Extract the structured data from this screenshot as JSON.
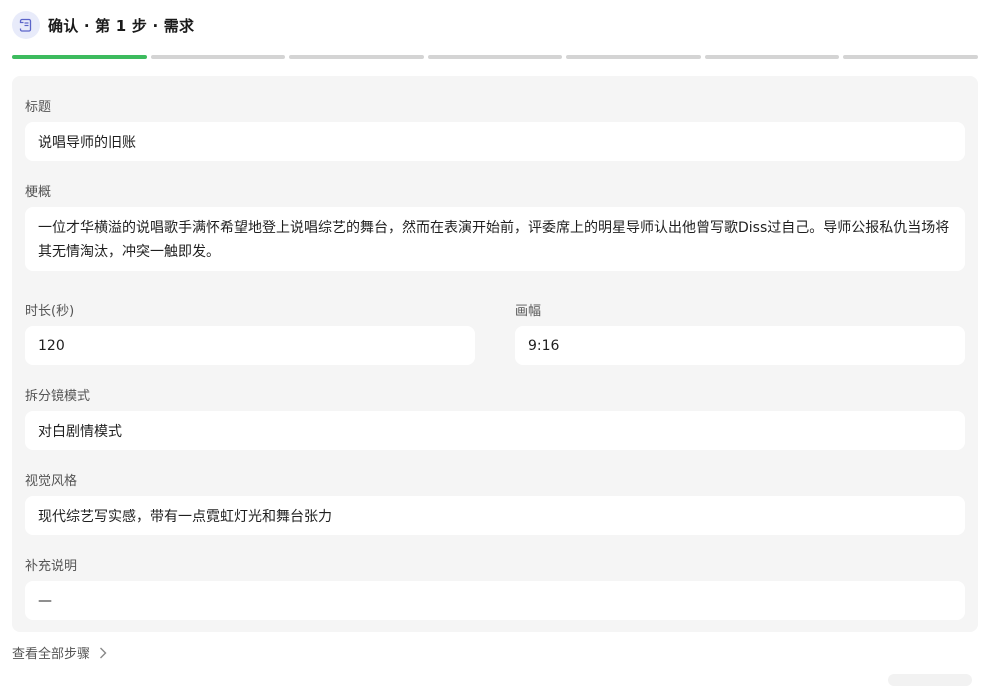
{
  "header": {
    "title": "确认 · 第 1 步 · 需求",
    "icon": "scroll-icon"
  },
  "progress": {
    "total_steps": 7,
    "current_step": 1,
    "done_color": "#3dbb5e",
    "todo_color": "#d4d4d4"
  },
  "form": {
    "title_label": "标题",
    "title_value": "说唱导师的旧账",
    "synopsis_label": "梗概",
    "synopsis_value": "一位才华横溢的说唱歌手满怀希望地登上说唱综艺的舞台，然而在表演开始前，评委席上的明星导师认出他曾写歌Diss过自己。导师公报私仇当场将其无情淘汰，冲突一触即发。",
    "duration_label": "时长(秒)",
    "duration_value": "120",
    "aspect_label": "画幅",
    "aspect_value": "9:16",
    "storyboard_label": "拆分镜模式",
    "storyboard_value": "对白剧情模式",
    "style_label": "视觉风格",
    "style_value": "现代综艺写实感，带有一点霓虹灯光和舞台张力",
    "notes_label": "补充说明",
    "notes_value": "—"
  },
  "footer": {
    "view_all_label": "查看全部步骤",
    "icon": "chevron-right-icon"
  }
}
